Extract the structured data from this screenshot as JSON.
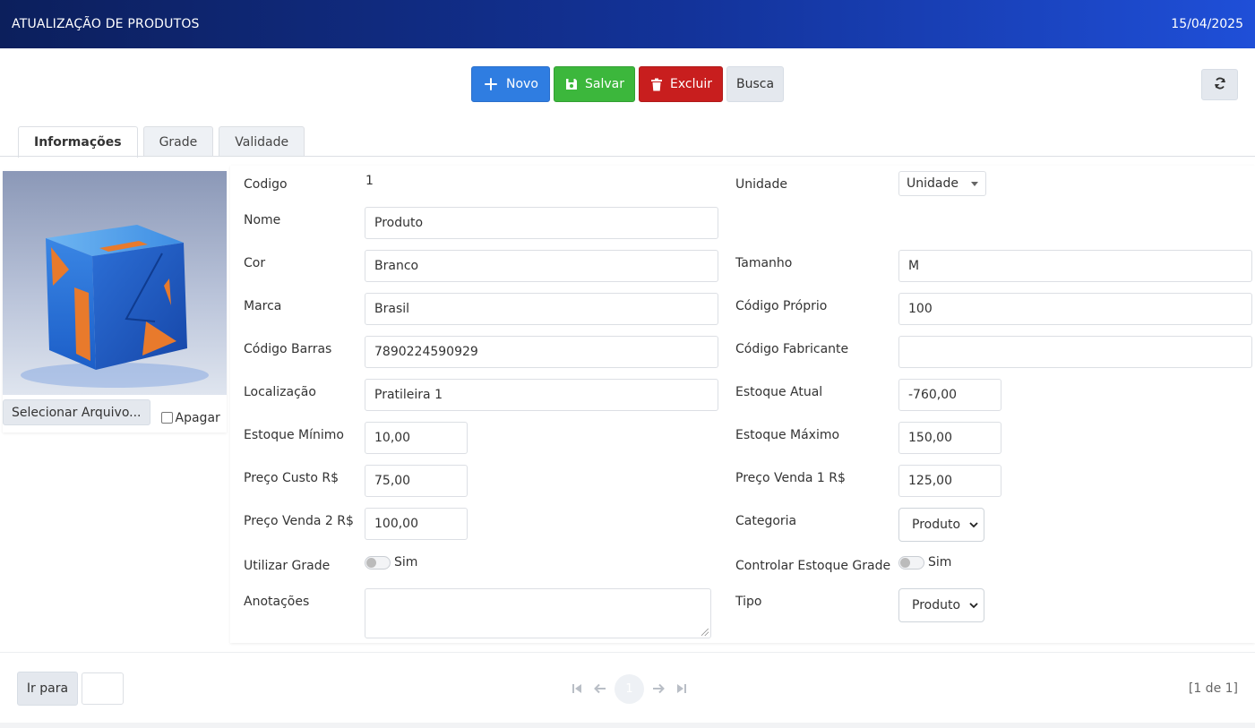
{
  "header": {
    "title": "ATUALIZAÇÃO DE PRODUTOS",
    "date": "15/04/2025"
  },
  "toolbar": {
    "novo": "Novo",
    "salvar": "Salvar",
    "excluir": "Excluir",
    "busca": "Busca"
  },
  "tabs": [
    {
      "label": "Informações",
      "active": true
    },
    {
      "label": "Grade",
      "active": false
    },
    {
      "label": "Validade",
      "active": false
    }
  ],
  "image_panel": {
    "select_file": "Selecionar Arquivo...",
    "apagar": "Apagar"
  },
  "form": {
    "codigo": {
      "label": "Codigo",
      "value": "1"
    },
    "nome": {
      "label": "Nome",
      "value": "Produto"
    },
    "cor": {
      "label": "Cor",
      "value": "Branco"
    },
    "marca": {
      "label": "Marca",
      "value": "Brasil"
    },
    "codigo_barras": {
      "label": "Código Barras",
      "value": "7890224590929"
    },
    "localizacao": {
      "label": "Localização",
      "value": "Pratileira 1"
    },
    "estoque_minimo": {
      "label": "Estoque Mínimo",
      "value": "10,00"
    },
    "preco_custo": {
      "label": "Preço Custo R$",
      "value": "75,00"
    },
    "preco_venda2": {
      "label": "Preço Venda 2 R$",
      "value": "100,00"
    },
    "utilizar_grade": {
      "label": "Utilizar Grade",
      "toggle_label": "Sim"
    },
    "anotacoes": {
      "label": "Anotações",
      "value": ""
    },
    "unidade": {
      "label": "Unidade",
      "value": "Unidade"
    },
    "tamanho": {
      "label": "Tamanho",
      "value": "M"
    },
    "codigo_proprio": {
      "label": "Código Próprio",
      "value": "100"
    },
    "codigo_fabricante": {
      "label": "Código Fabricante",
      "value": ""
    },
    "estoque_atual": {
      "label": "Estoque Atual",
      "value": "-760,00"
    },
    "estoque_maximo": {
      "label": "Estoque Máximo",
      "value": "150,00"
    },
    "preco_venda1": {
      "label": "Preço Venda 1 R$",
      "value": "125,00"
    },
    "categoria": {
      "label": "Categoria",
      "value": "Produto"
    },
    "controlar_estoque_grade": {
      "label": "Controlar Estoque Grade",
      "toggle_label": "Sim"
    },
    "tipo": {
      "label": "Tipo",
      "value": "Produto"
    }
  },
  "footer": {
    "ir_para": "Ir para",
    "current_page": "1",
    "page_info": "[1 de 1]"
  },
  "colors": {
    "novo": "#2f7de1",
    "salvar": "#3cb73c",
    "excluir": "#c81e1e",
    "header_start": "#0c1f5c",
    "header_end": "#1f4fd8"
  }
}
